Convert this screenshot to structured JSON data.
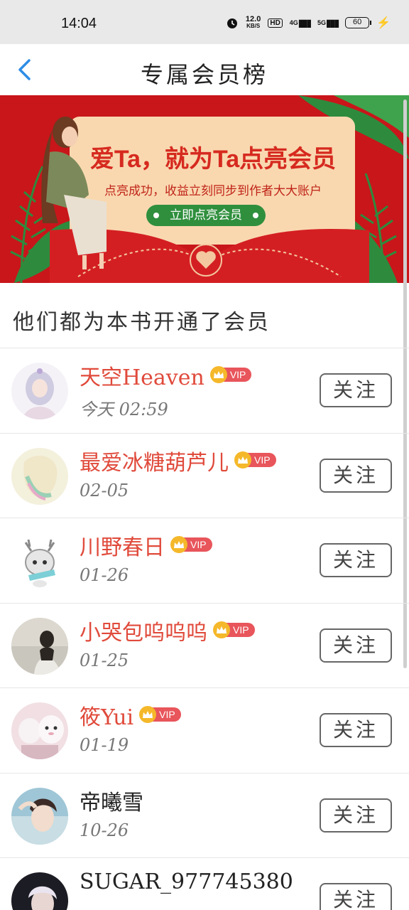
{
  "status_bar": {
    "time": "14:04",
    "speed_value": "12.0",
    "speed_unit": "KB/S",
    "hd_label": "HD",
    "net_4g": "4G",
    "net_5g": "5G",
    "battery": "60",
    "icons": [
      "alarm-icon",
      "signal-4g-icon",
      "signal-5g-icon",
      "battery-icon",
      "charging-icon"
    ]
  },
  "header": {
    "title": "专属会员榜",
    "back_icon": "chevron-left-icon"
  },
  "banner": {
    "headline": "爱Ta，就为Ta点亮会员",
    "subtitle": "点亮成功，收益立刻同步到作者大大账户",
    "cta": "立即点亮会员",
    "colors": {
      "background": "#c8161a",
      "card": "#f9d8b0",
      "button": "#2f8f3d",
      "leaf": "#2e8b3e"
    }
  },
  "section_title": "他们都为本书开通了会员",
  "vip_label": "VIP",
  "follow_label": "关注",
  "members": [
    {
      "name": "天空Heaven",
      "date": "今天 02:59",
      "vip": true
    },
    {
      "name": "最爱冰糖葫芦儿",
      "date": "02-05",
      "vip": true
    },
    {
      "name": "川野春日",
      "date": "01-26",
      "vip": true
    },
    {
      "name": "小哭包呜呜呜",
      "date": "01-25",
      "vip": true
    },
    {
      "name": "筱Yui",
      "date": "01-19",
      "vip": true
    },
    {
      "name": "帝曦雪",
      "date": "10-26",
      "vip": false
    },
    {
      "name": "SUGAR_977745380",
      "date": "",
      "vip": false
    }
  ],
  "colors": {
    "accent_blue": "#2e8de6",
    "vip_name": "#e04a3b",
    "vip_badge": "#e8555b",
    "crown": "#f5b82a"
  }
}
